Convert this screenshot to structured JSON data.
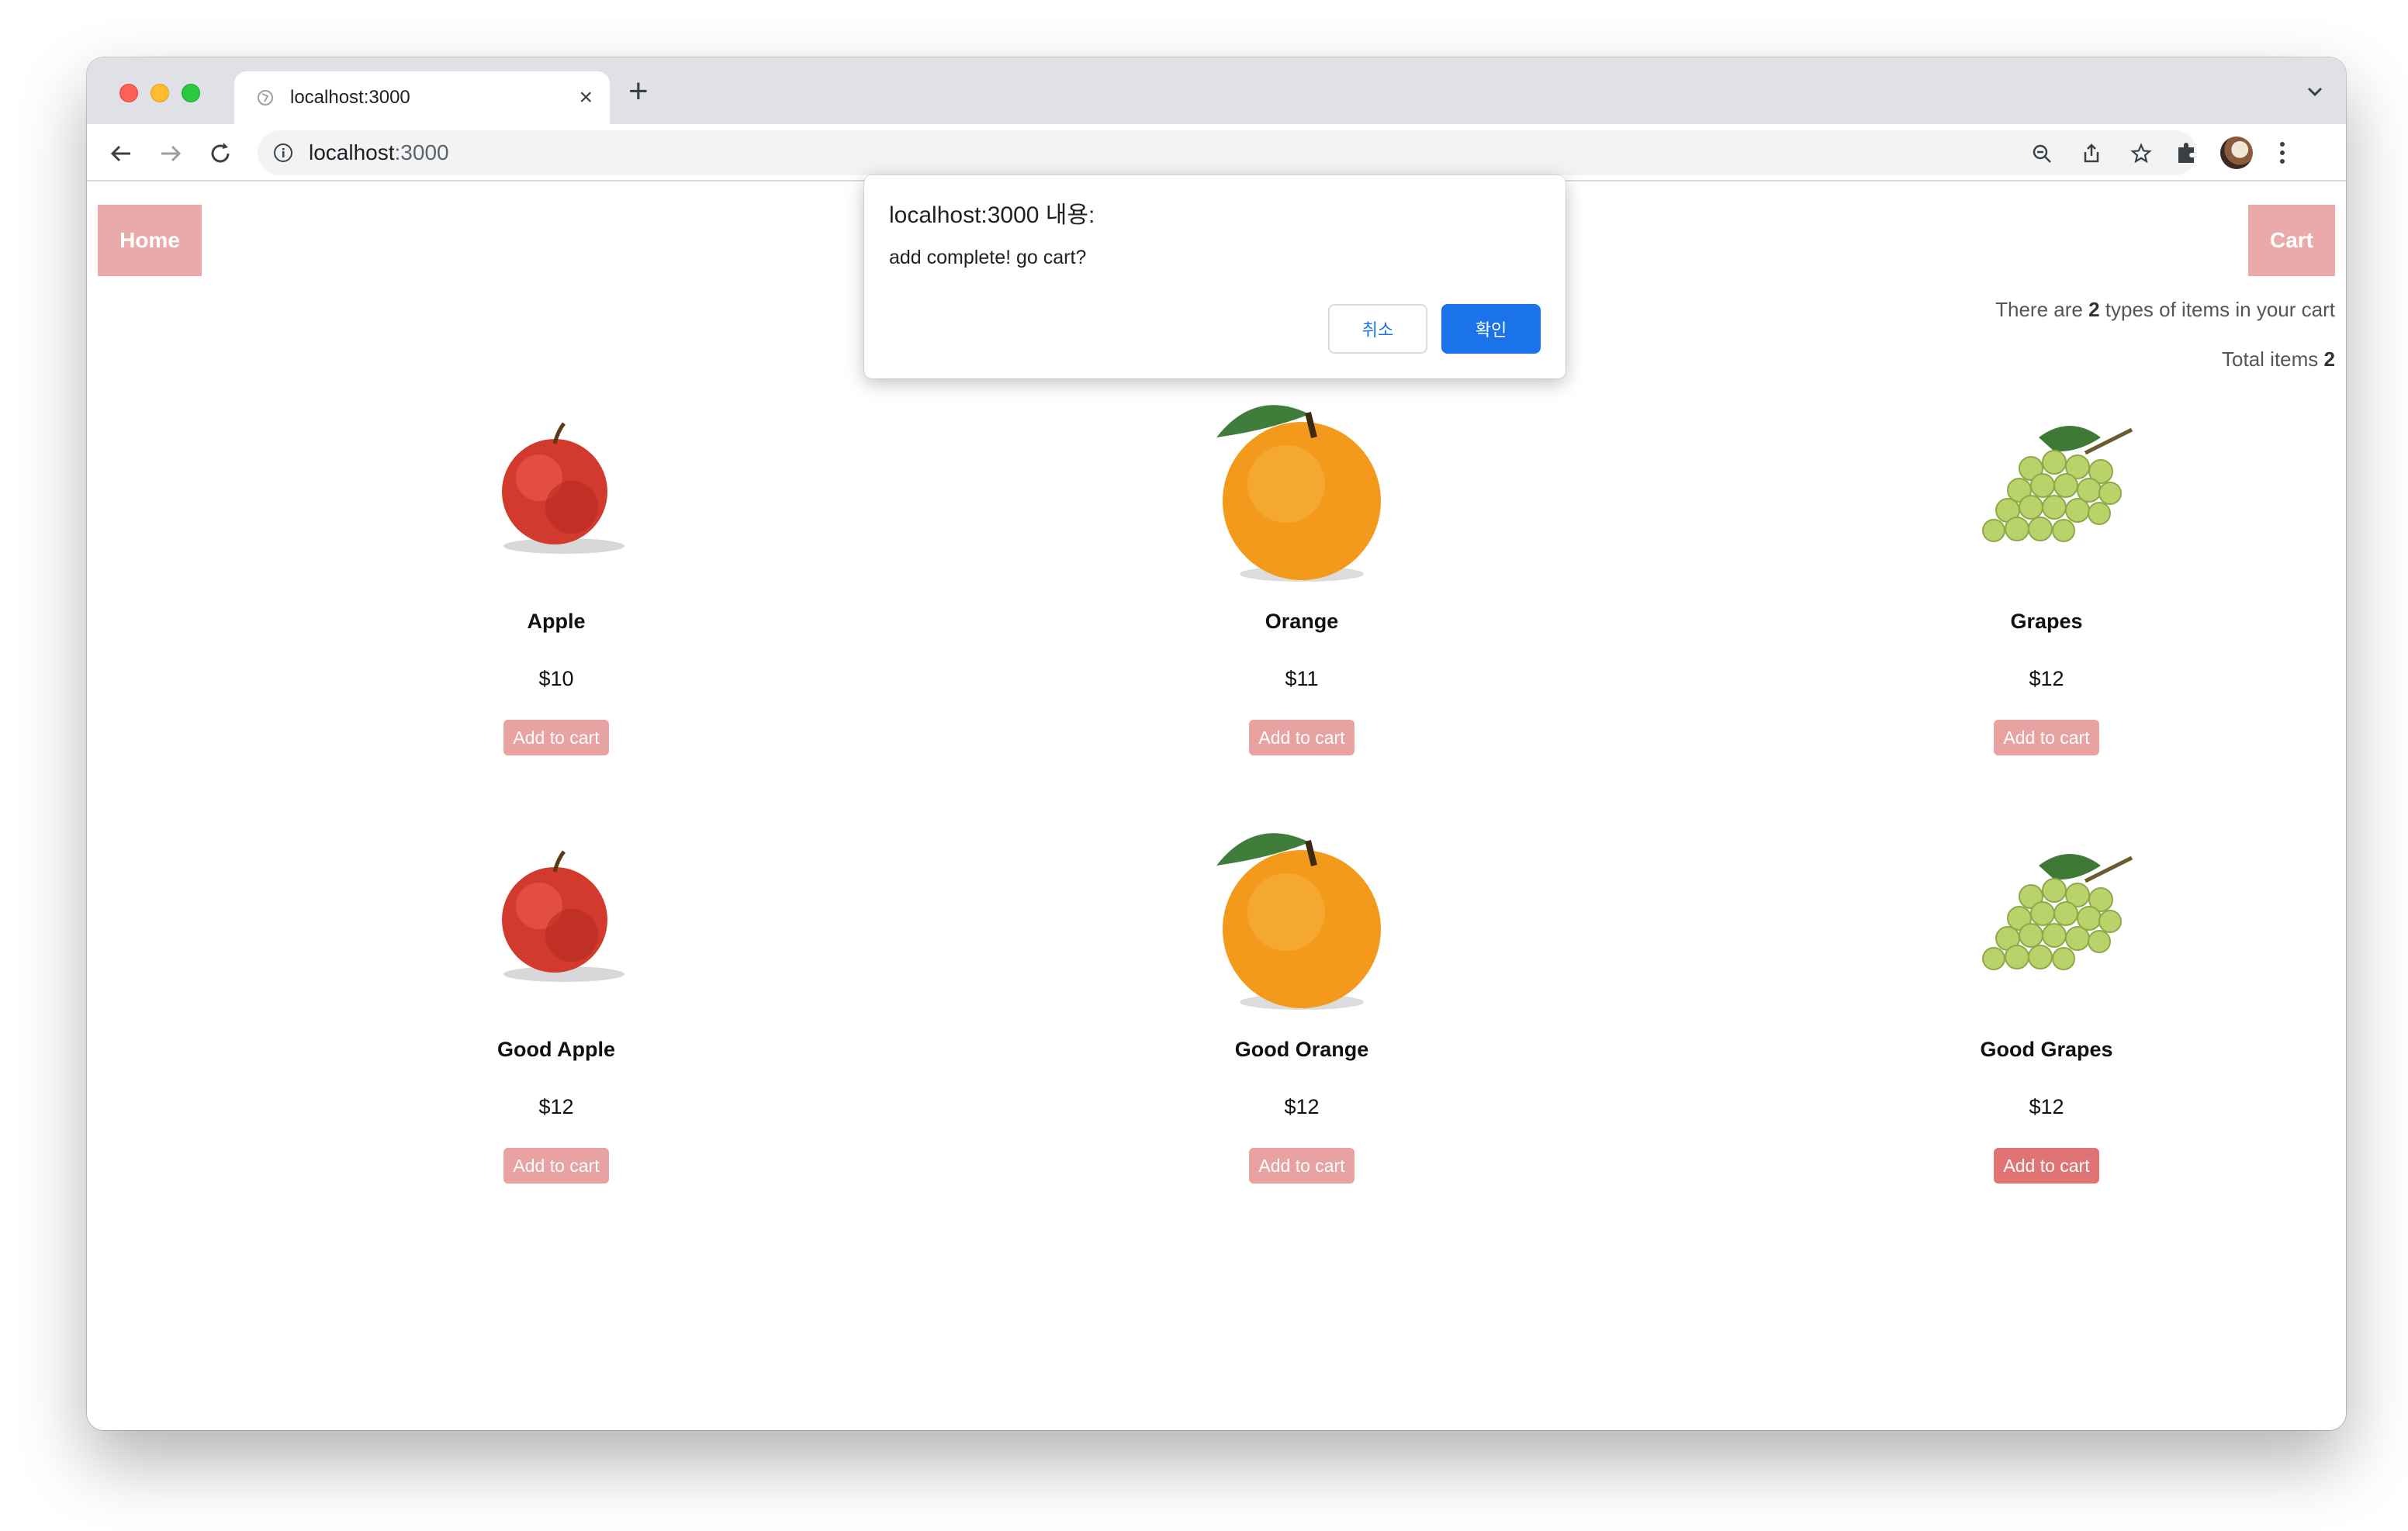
{
  "browser": {
    "tab_title": "localhost:3000",
    "new_tab": "+",
    "tab_close": "×",
    "url_host": "localhost",
    "url_port": ":3000"
  },
  "header": {
    "home_label": "Home",
    "cart_label": "Cart",
    "cart_types_prefix": "There are ",
    "cart_types_count": "2",
    "cart_types_suffix": " types of items in your cart",
    "total_prefix": "Total items ",
    "total_count": "2"
  },
  "products": [
    {
      "name": "Apple",
      "price": "$10",
      "button": "Add to cart",
      "icon": "apple-image"
    },
    {
      "name": "Orange",
      "price": "$11",
      "button": "Add to cart",
      "icon": "orange-image"
    },
    {
      "name": "Grapes",
      "price": "$12",
      "button": "Add to cart",
      "icon": "grapes-image"
    },
    {
      "name": "Good Apple",
      "price": "$12",
      "button": "Add to cart",
      "icon": "apple-image"
    },
    {
      "name": "Good Orange",
      "price": "$12",
      "button": "Add to cart",
      "icon": "orange-image"
    },
    {
      "name": "Good Grapes",
      "price": "$12",
      "button": "Add to cart",
      "icon": "grapes-image"
    }
  ],
  "dialog": {
    "title": "localhost:3000 내용:",
    "message": "add complete! go cart?",
    "cancel": "취소",
    "ok": "확인"
  },
  "colors": {
    "button_pink": "#eaaaaa",
    "button_active": "#e07474",
    "dialog_accent": "#1a73e8"
  }
}
